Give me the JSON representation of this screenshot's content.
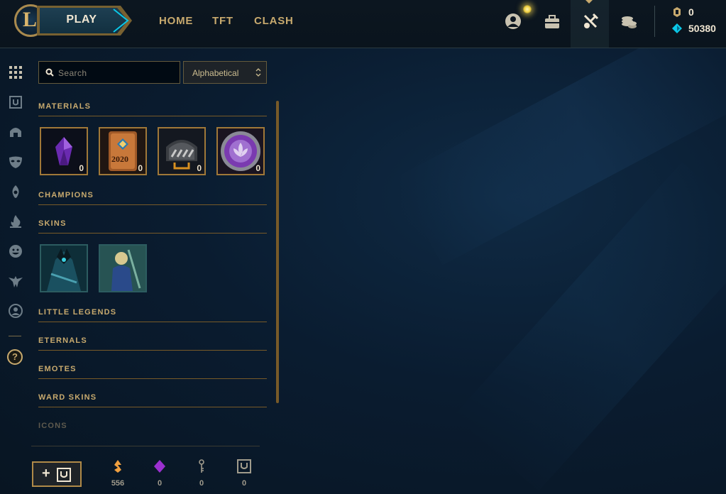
{
  "topbar": {
    "logo": "league-logo",
    "play_label": "PLAY",
    "nav": [
      {
        "label": "HOME"
      },
      {
        "label": "TFT"
      },
      {
        "label": "CLASH"
      }
    ],
    "icons": [
      "profile-icon",
      "collection-icon",
      "loot-icon",
      "store-icon"
    ],
    "active_icon": "loot-icon",
    "currency": {
      "rp": {
        "icon": "rp-icon",
        "value": "0"
      },
      "be": {
        "icon": "blue-essence-icon",
        "value": "50380"
      }
    }
  },
  "rail": {
    "icons": [
      "all-grid-icon",
      "chest-icon",
      "helmet-icon",
      "mask-icon",
      "ward-icon",
      "fire-icon",
      "emote-icon",
      "crest-icon",
      "profile-circle-icon"
    ],
    "help_label": "?"
  },
  "search": {
    "placeholder": "Search",
    "value": ""
  },
  "sort": {
    "selected": "Alphabetical"
  },
  "sections": {
    "materials": "MATERIALS",
    "champions": "CHAMPIONS",
    "skins": "SKINS",
    "little_legends": "LITTLE LEGENDS",
    "eternals": "ETERNALS",
    "emotes": "EMOTES",
    "ward_skins": "WARD SKINS",
    "icons": "ICONS"
  },
  "materials": [
    {
      "name": "purple-gem",
      "count": "0"
    },
    {
      "name": "2020-pass-card",
      "count": "0",
      "text": "2020"
    },
    {
      "name": "hextech-chest-dark",
      "count": "0"
    },
    {
      "name": "purple-lotus-orb",
      "count": "0"
    }
  ],
  "skins": [
    {
      "name": "skin-1"
    },
    {
      "name": "skin-2"
    }
  ],
  "bottom": {
    "craft_plus": "+",
    "essences": [
      {
        "icon": "orange-essence-icon",
        "value": "556",
        "color": "#f0a040"
      },
      {
        "icon": "gemstone-icon",
        "value": "0",
        "color": "#9b30d0"
      },
      {
        "icon": "key-icon",
        "value": "0",
        "color": "#a09b8c"
      },
      {
        "icon": "chest-icon",
        "value": "0",
        "color": "#a09b8c"
      }
    ]
  },
  "colors": {
    "gold": "#c8aa6e",
    "cyan": "#0ac8e8",
    "background": "#0a1c30"
  }
}
